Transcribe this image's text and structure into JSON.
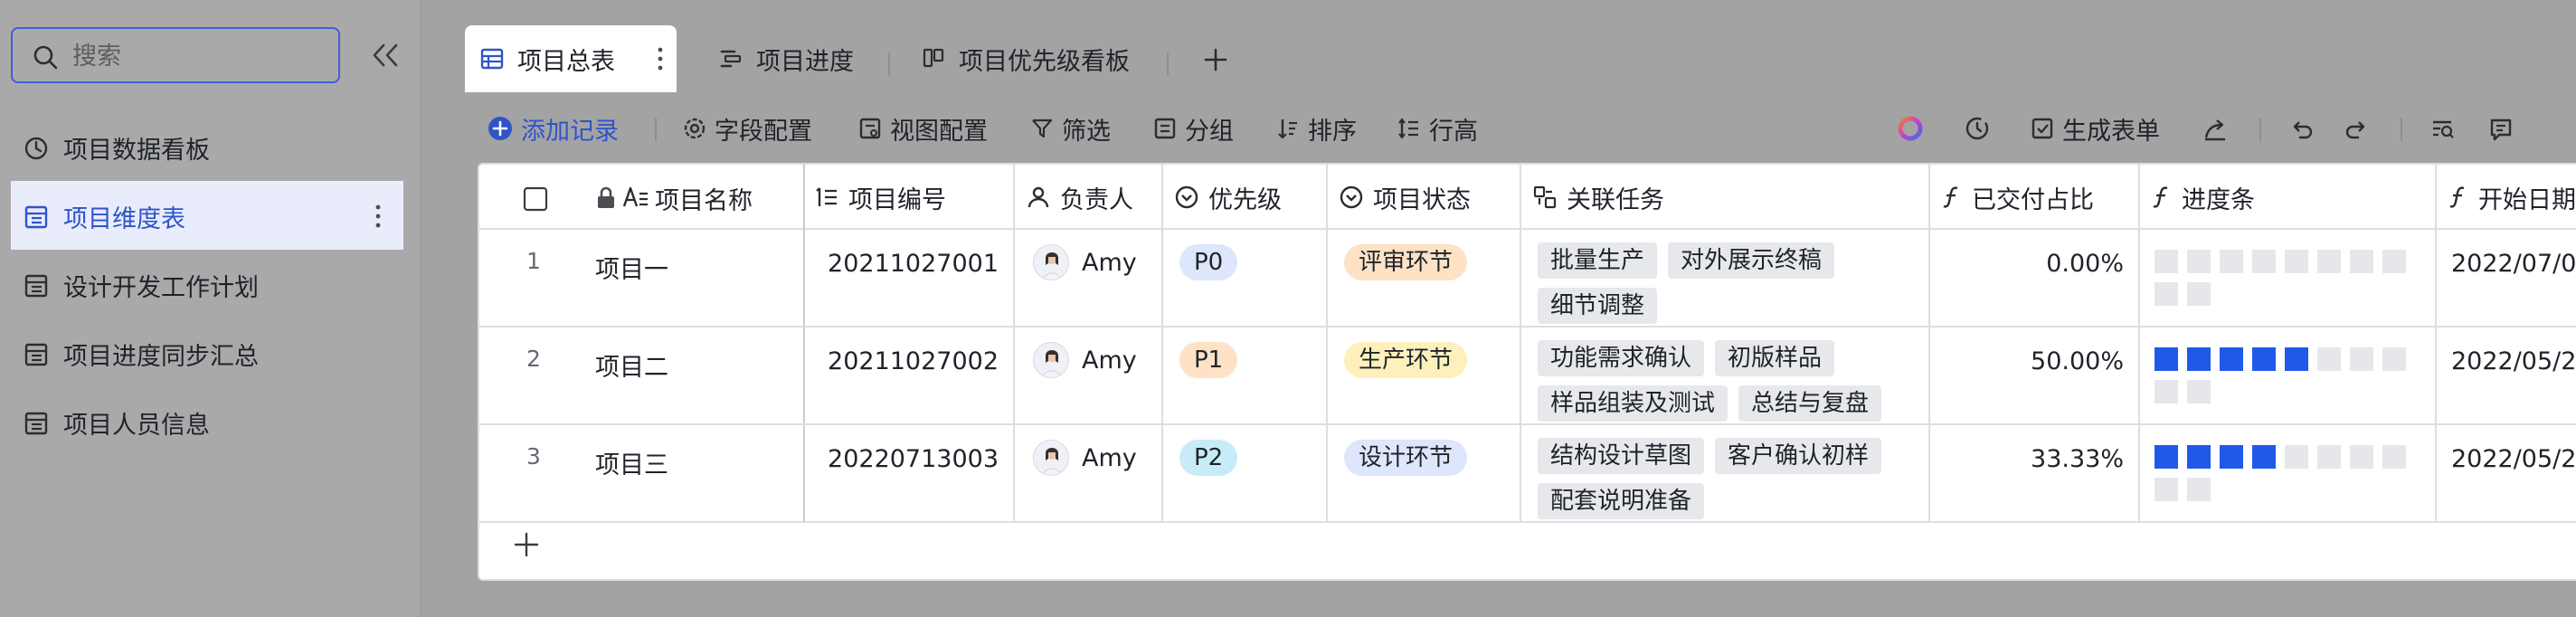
{
  "search": {
    "placeholder": "搜索"
  },
  "sidebar": {
    "items": [
      {
        "label": "项目数据看板",
        "icon": "dashboard-icon"
      },
      {
        "label": "项目维度表",
        "icon": "table-icon"
      },
      {
        "label": "设计开发工作计划",
        "icon": "table-icon"
      },
      {
        "label": "项目进度同步汇总",
        "icon": "table-icon"
      },
      {
        "label": "项目人员信息",
        "icon": "table-icon"
      }
    ]
  },
  "tabs": [
    {
      "label": "项目总表",
      "icon": "grid-icon"
    },
    {
      "label": "项目进度",
      "icon": "gantt-icon"
    },
    {
      "label": "项目优先级看板",
      "icon": "kanban-icon"
    }
  ],
  "toolbar": {
    "add_record": "添加记录",
    "field_config": "字段配置",
    "view_config": "视图配置",
    "filter": "筛选",
    "group": "分组",
    "sort": "排序",
    "row_height": "行高",
    "generate_form": "生成表单"
  },
  "table": {
    "headers": {
      "name": "项目名称",
      "code": "项目编号",
      "owner": "负责人",
      "priority": "优先级",
      "status": "项目状态",
      "tasks": "关联任务",
      "delivered": "已交付占比",
      "progress": "进度条",
      "start": "开始日期"
    },
    "rows": [
      {
        "index": "1",
        "name": "项目一",
        "code": "20211027001",
        "owner": "Amy",
        "priority": "P0",
        "status": "评审环节",
        "tasks": [
          "批量生产",
          "对外展示终稿",
          "细节调整"
        ],
        "delivered": "0.00%",
        "progress_filled": 0,
        "progress_total": 10,
        "start": "2022/07/0"
      },
      {
        "index": "2",
        "name": "项目二",
        "code": "20211027002",
        "owner": "Amy",
        "priority": "P1",
        "status": "生产环节",
        "tasks": [
          "功能需求确认",
          "初版样品",
          "样品组装及测试",
          "总结与复盘"
        ],
        "delivered": "50.00%",
        "progress_filled": 5,
        "progress_total": 10,
        "start": "2022/05/2"
      },
      {
        "index": "3",
        "name": "项目三",
        "code": "20220713003",
        "owner": "Amy",
        "priority": "P2",
        "status": "设计环节",
        "tasks": [
          "结构设计草图",
          "客户确认初样",
          "配套说明准备"
        ],
        "delivered": "33.33%",
        "progress_filled": 4,
        "progress_total": 10,
        "start": "2022/05/2"
      }
    ]
  },
  "colors": {
    "accent": "#2f54c8",
    "priority_p0_bg": "#dde6fb",
    "priority_p1_bg": "#fde2c6",
    "priority_p2_bg": "#c8ecf7",
    "status_review_bg": "#fde2c6",
    "status_production_bg": "#fdf0bd",
    "status_design_bg": "#dde6fb",
    "progress_on": "#2059e8"
  }
}
